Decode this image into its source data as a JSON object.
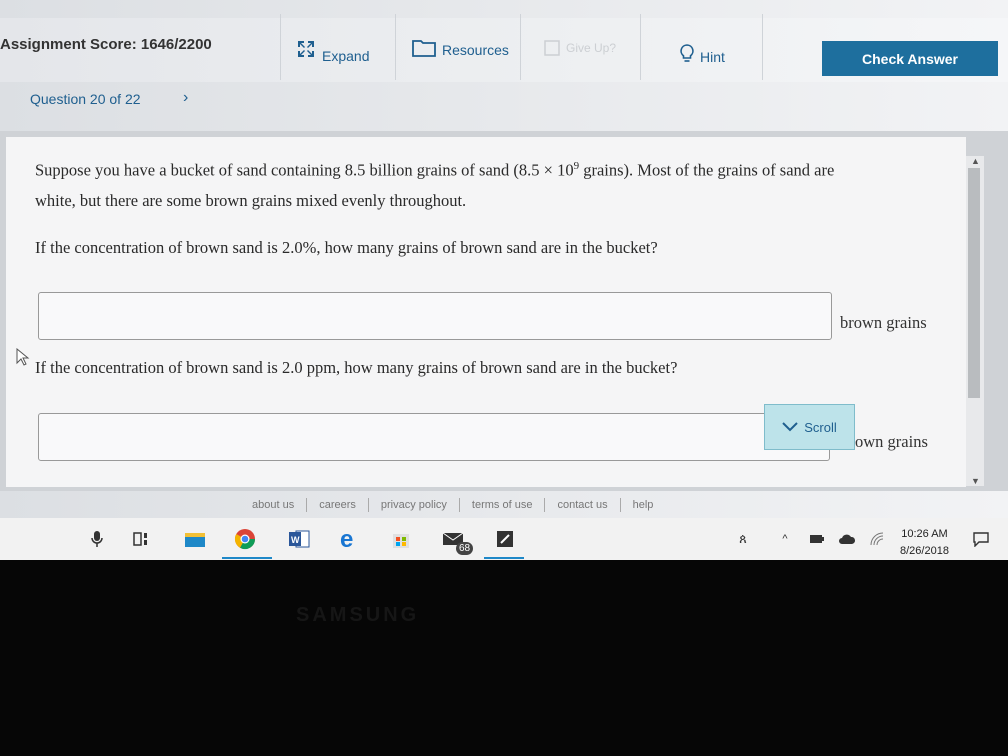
{
  "header": {
    "score_label": "Assignment Score: 1646/2200",
    "expand_label": "Expand",
    "resources_label": "Resources",
    "give_up_label": "Give Up?",
    "hint_label": "Hint",
    "check_answer_label": "Check Answer"
  },
  "nav": {
    "question_label": "Question 20 of 22",
    "next_glyph": "›"
  },
  "question": {
    "intro_line1_a": "Suppose you have a bucket of sand containing 8.5 billion grains of sand (8.5 × 10",
    "intro_exp": "9",
    "intro_line1_b": " grains). Most of the grains of sand are",
    "intro_line2": "white, but there are some brown grains mixed evenly throughout.",
    "part1_prompt": "If the concentration of brown sand is 2.0%, how many grains of brown sand are in the bucket?",
    "part1_value": "",
    "part1_unit": "brown grains",
    "part2_prompt": "If the concentration of brown sand is 2.0 ppm, how many grains of brown sand are in the bucket?",
    "part2_value": "",
    "part2_unit": "own grains",
    "scroll_label": "Scroll"
  },
  "footer": {
    "links": [
      "about us",
      "careers",
      "privacy policy",
      "terms of use",
      "contact us",
      "help"
    ]
  },
  "taskbar": {
    "mail_badge": "68",
    "time": "10:26 AM",
    "date": "8/26/2018",
    "icons": [
      "microphone-icon",
      "task-view-icon",
      "file-explorer-icon",
      "chrome-icon",
      "word-icon",
      "edge-icon",
      "store-icon",
      "mail-icon",
      "app-icon",
      "people-icon",
      "chevron-up-icon",
      "battery-icon",
      "onedrive-icon",
      "wifi-icon",
      "notifications-icon"
    ]
  },
  "bezel": {
    "brand": "SAMSUNG"
  },
  "colors": {
    "accent": "#1e6f9e",
    "link": "#1f5f8f",
    "scroll_button": "#bde3ea"
  }
}
